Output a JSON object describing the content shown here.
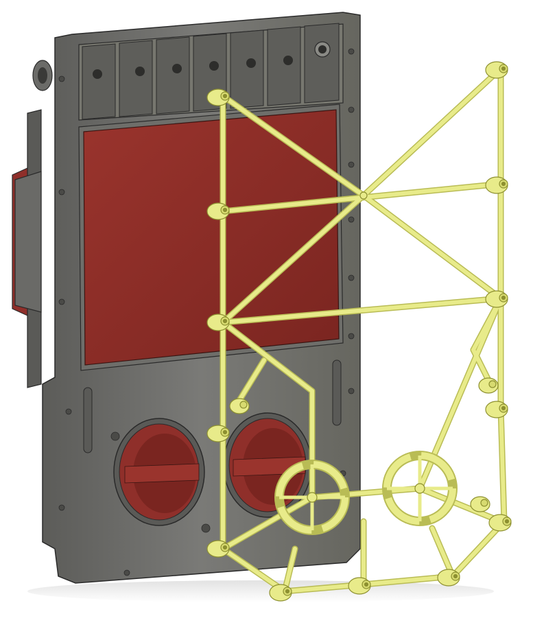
{
  "scene": {
    "description_visible_text": "",
    "colors": {
      "background": "#ffffff",
      "plate": "#6f6f6c",
      "plate_dark": "#4f4f4d",
      "plate_light": "#8a8a87",
      "red_panel": "#8f2f2a",
      "red_panel_dark": "#6e1f1b",
      "yellow_frame": "#e8eb8a",
      "yellow_frame_dark": "#b9bc55",
      "outline": "#2a2a2a"
    },
    "components": {
      "plate": "gray-base-plate",
      "panel": "red-recessed-panel",
      "frame": "yellow-truss-frame",
      "ports": "round-red-ports"
    }
  }
}
